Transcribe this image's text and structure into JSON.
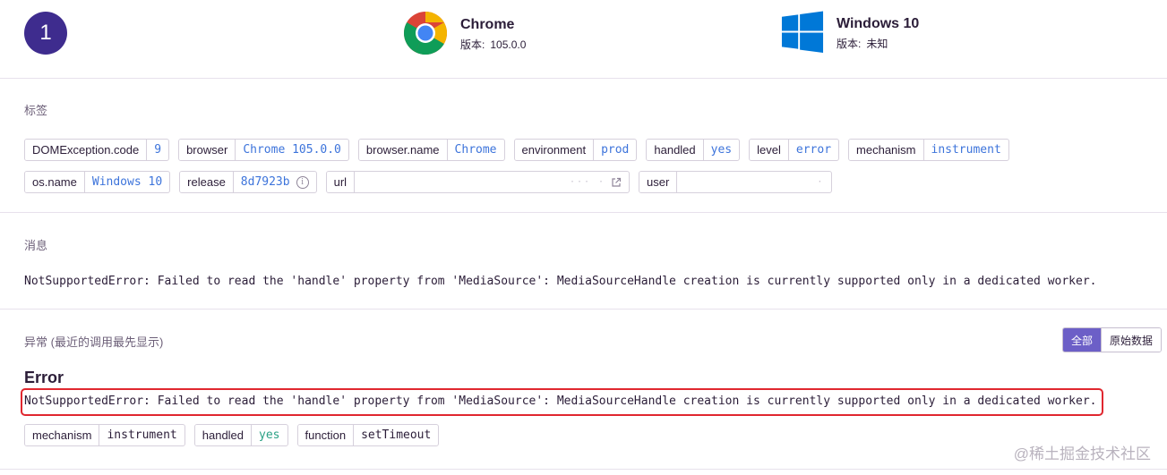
{
  "header": {
    "event_number": "1",
    "browser": {
      "name": "Chrome",
      "version_label": "版本:",
      "version": "105.0.0"
    },
    "os": {
      "name": "Windows 10",
      "version_label": "版本:",
      "version": "未知"
    }
  },
  "tags_section": {
    "title": "标签",
    "row1": [
      {
        "key": "DOMException.code",
        "value": "9"
      },
      {
        "key": "browser",
        "value": "Chrome 105.0.0"
      },
      {
        "key": "browser.name",
        "value": "Chrome"
      },
      {
        "key": "environment",
        "value": "prod"
      },
      {
        "key": "handled",
        "value": "yes"
      },
      {
        "key": "level",
        "value": "error"
      },
      {
        "key": "mechanism",
        "value": "instrument"
      }
    ],
    "row2": [
      {
        "key": "os.name",
        "value": "Windows 10"
      },
      {
        "key": "release",
        "value": "8d7923b"
      },
      {
        "key": "url",
        "value": "··· ·"
      },
      {
        "key": "user",
        "value": "·"
      }
    ]
  },
  "message_section": {
    "title": "消息",
    "text": "NotSupportedError: Failed to read the 'handle' property from 'MediaSource': MediaSourceHandle creation is currently supported only in a dedicated worker."
  },
  "exception_section": {
    "title": "异常 (最近的调用最先显示)",
    "buttons": [
      "全部",
      "原始数据"
    ],
    "error_type": "Error",
    "error_value": "NotSupportedError: Failed to read the 'handle' property from 'MediaSource': MediaSourceHandle creation is currently supported only in a dedicated worker.",
    "mechanism_tags": [
      {
        "key": "mechanism",
        "value": "instrument"
      },
      {
        "key": "handled",
        "value": "yes"
      },
      {
        "key": "function",
        "value": "setTimeout"
      }
    ]
  },
  "watermark": "@稀土掘金技术社区",
  "colors": {
    "accent": "#6c5fc7",
    "badge": "#3e2c8e",
    "tag_value": "#3d74db",
    "highlight": "#e0272f",
    "green": "#2ba185"
  },
  "icons": [
    "chrome-logo-icon",
    "windows-logo-icon",
    "info-icon",
    "external-link-icon"
  ]
}
